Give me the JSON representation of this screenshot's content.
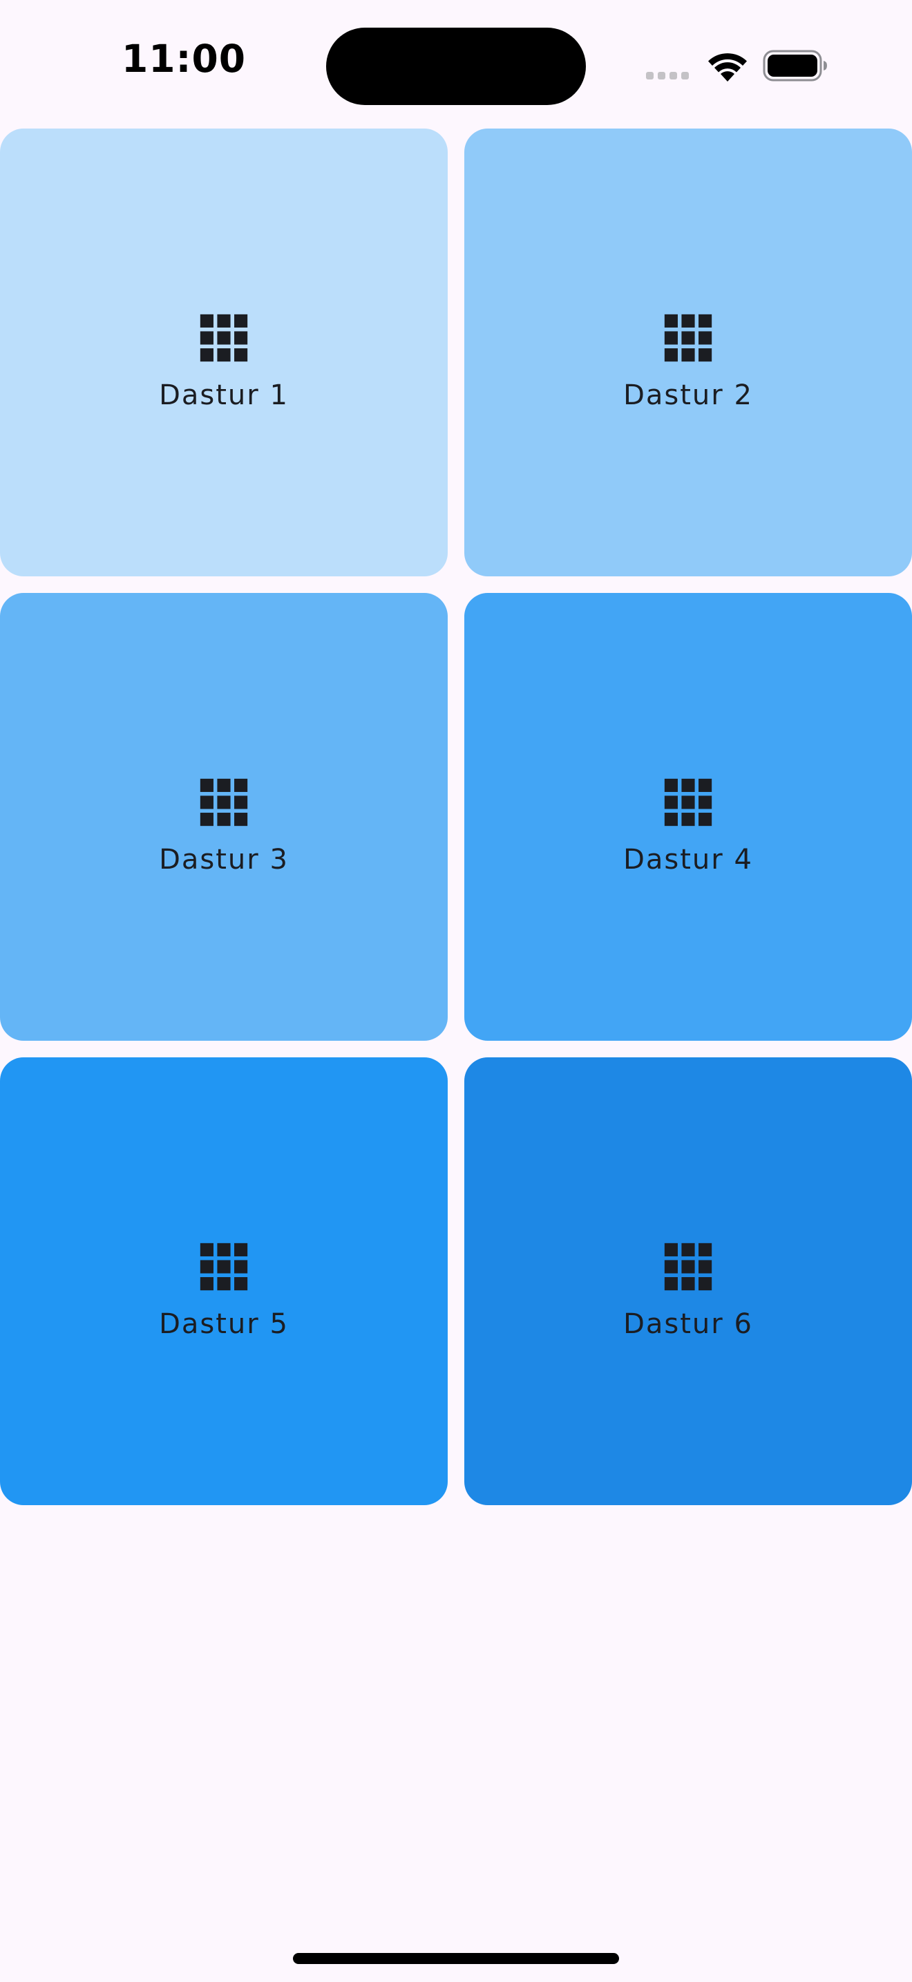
{
  "status_bar": {
    "time": "11:00",
    "icons": [
      "cellular-signal-icon",
      "wifi-icon",
      "battery-icon"
    ]
  },
  "grid": {
    "tiles": [
      {
        "label": "Dastur 1",
        "icon": "grid-icon",
        "color": "#bbdefb"
      },
      {
        "label": "Dastur 2",
        "icon": "grid-icon",
        "color": "#90caf9"
      },
      {
        "label": "Dastur 3",
        "icon": "grid-icon",
        "color": "#64b5f6"
      },
      {
        "label": "Dastur 4",
        "icon": "grid-icon",
        "color": "#42a5f5"
      },
      {
        "label": "Dastur 5",
        "icon": "grid-icon",
        "color": "#2196f3"
      },
      {
        "label": "Dastur 6",
        "icon": "grid-icon",
        "color": "#1e88e5"
      }
    ]
  },
  "colors": {
    "background": "#fdf7fe",
    "icon": "#1b1d22",
    "label": "#1b1d22"
  }
}
